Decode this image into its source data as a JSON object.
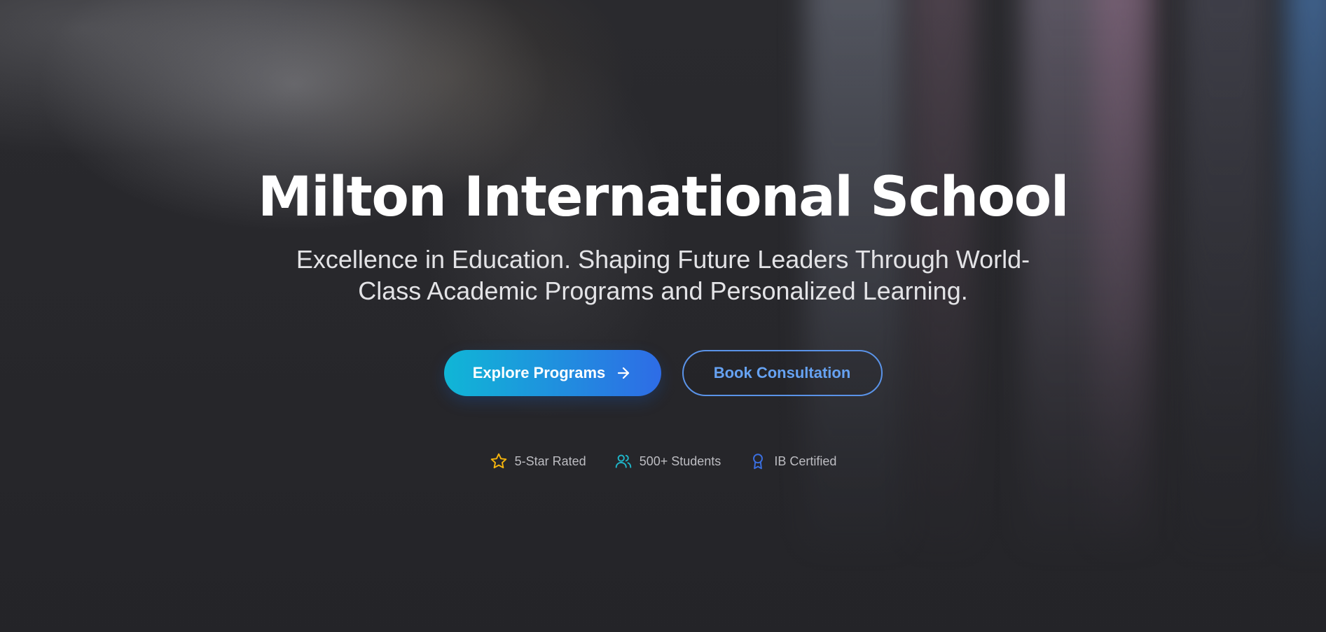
{
  "hero": {
    "title": "Milton International School",
    "subtitle": "Excellence in Education. Shaping Future Leaders Through World-Class Academic Programs and Personalized Learning.",
    "primary_button": {
      "label": "Explore Programs",
      "icon": "arrow-right-icon"
    },
    "secondary_button": {
      "label": "Book Consultation"
    },
    "badges": [
      {
        "icon": "star-icon",
        "label": "5-Star Rated",
        "color": "#f5b40d"
      },
      {
        "icon": "users-icon",
        "label": "500+ Students",
        "color": "#1fb6c9"
      },
      {
        "icon": "award-icon",
        "label": "IB Certified",
        "color": "#3b6fe0"
      }
    ]
  },
  "colors": {
    "primary_gradient_start": "#10b6d6",
    "primary_gradient_end": "#2e6ce6",
    "outline_accent": "#5a93e8",
    "background": "#26262a"
  }
}
